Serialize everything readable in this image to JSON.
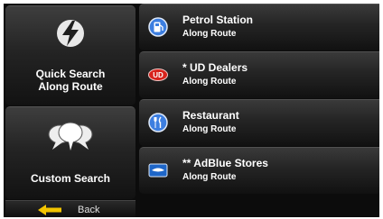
{
  "left_panel": {
    "quick_search": {
      "line1": "Quick Search",
      "line2": "Along Route",
      "icon": "lightning-icon"
    },
    "custom_search": {
      "label": "Custom Search",
      "icon": "speech-bubbles-icon"
    },
    "back": {
      "label": "Back",
      "icon": "back-arrow-icon"
    }
  },
  "list": [
    {
      "title": "Petrol Station",
      "subtitle": "Along Route",
      "icon": "fuel-pump-icon"
    },
    {
      "title": "* UD Dealers",
      "subtitle": "Along Route",
      "icon": "ud-logo-icon"
    },
    {
      "title": "Restaurant",
      "subtitle": "Along Route",
      "icon": "fork-knife-icon"
    },
    {
      "title": "** AdBlue Stores",
      "subtitle": "Along Route",
      "icon": "adblue-icon"
    }
  ],
  "colors": {
    "background": "#0c0c0c",
    "text": "#ffffff",
    "icon_blue": "#3c7ee0",
    "icon_red": "#d8231c",
    "back_arrow": "#f2c400"
  }
}
